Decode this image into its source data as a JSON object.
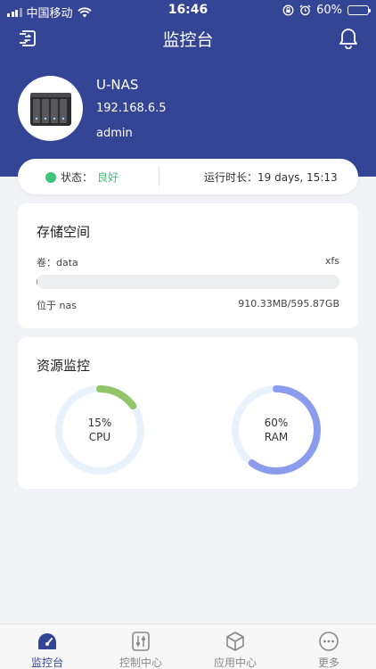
{
  "status_bar": {
    "carrier": "中国移动",
    "time": "16:46",
    "battery_percent": "60%",
    "battery_level": 0.6,
    "icons": [
      "signal-icon",
      "wifi-icon",
      "rotation-lock-icon",
      "alarm-icon",
      "battery-icon"
    ]
  },
  "nav": {
    "title": "监控台",
    "left_icon": "switch-device-icon",
    "right_icon": "bell-icon"
  },
  "device": {
    "name": "U-NAS",
    "ip": "192.168.6.5",
    "user": "admin",
    "image": "nas-device-image"
  },
  "status": {
    "label": "状态：",
    "value": "良好",
    "value_color": "#3fc27a",
    "uptime_label": "运行时长：",
    "uptime_value": "19 days, 15:13"
  },
  "storage": {
    "title": "存储空间",
    "volume": "卷：data",
    "filesystem": "xfs",
    "usage_fraction": 0.0015,
    "location": "位于 nas",
    "usage_text": "910.33MB/595.87GB"
  },
  "resources": {
    "title": "资源监控",
    "cpu": {
      "percent": 15,
      "percent_text": "15%",
      "label": "CPU",
      "color": "#94c46a"
    },
    "ram": {
      "percent": 60,
      "percent_text": "60%",
      "label": "RAM",
      "color": "#8c9cec"
    },
    "track_color": "#e9f1fd"
  },
  "tabs": [
    {
      "label": "监控台",
      "icon": "dashboard-icon",
      "active": true
    },
    {
      "label": "控制中心",
      "icon": "control-sliders-icon",
      "active": false
    },
    {
      "label": "应用中心",
      "icon": "cube-icon",
      "active": false
    },
    {
      "label": "更多",
      "icon": "more-icon",
      "active": false
    }
  ],
  "colors": {
    "header_bg": "#344596",
    "accent": "#344596",
    "page_bg": "#f2f3f7"
  }
}
